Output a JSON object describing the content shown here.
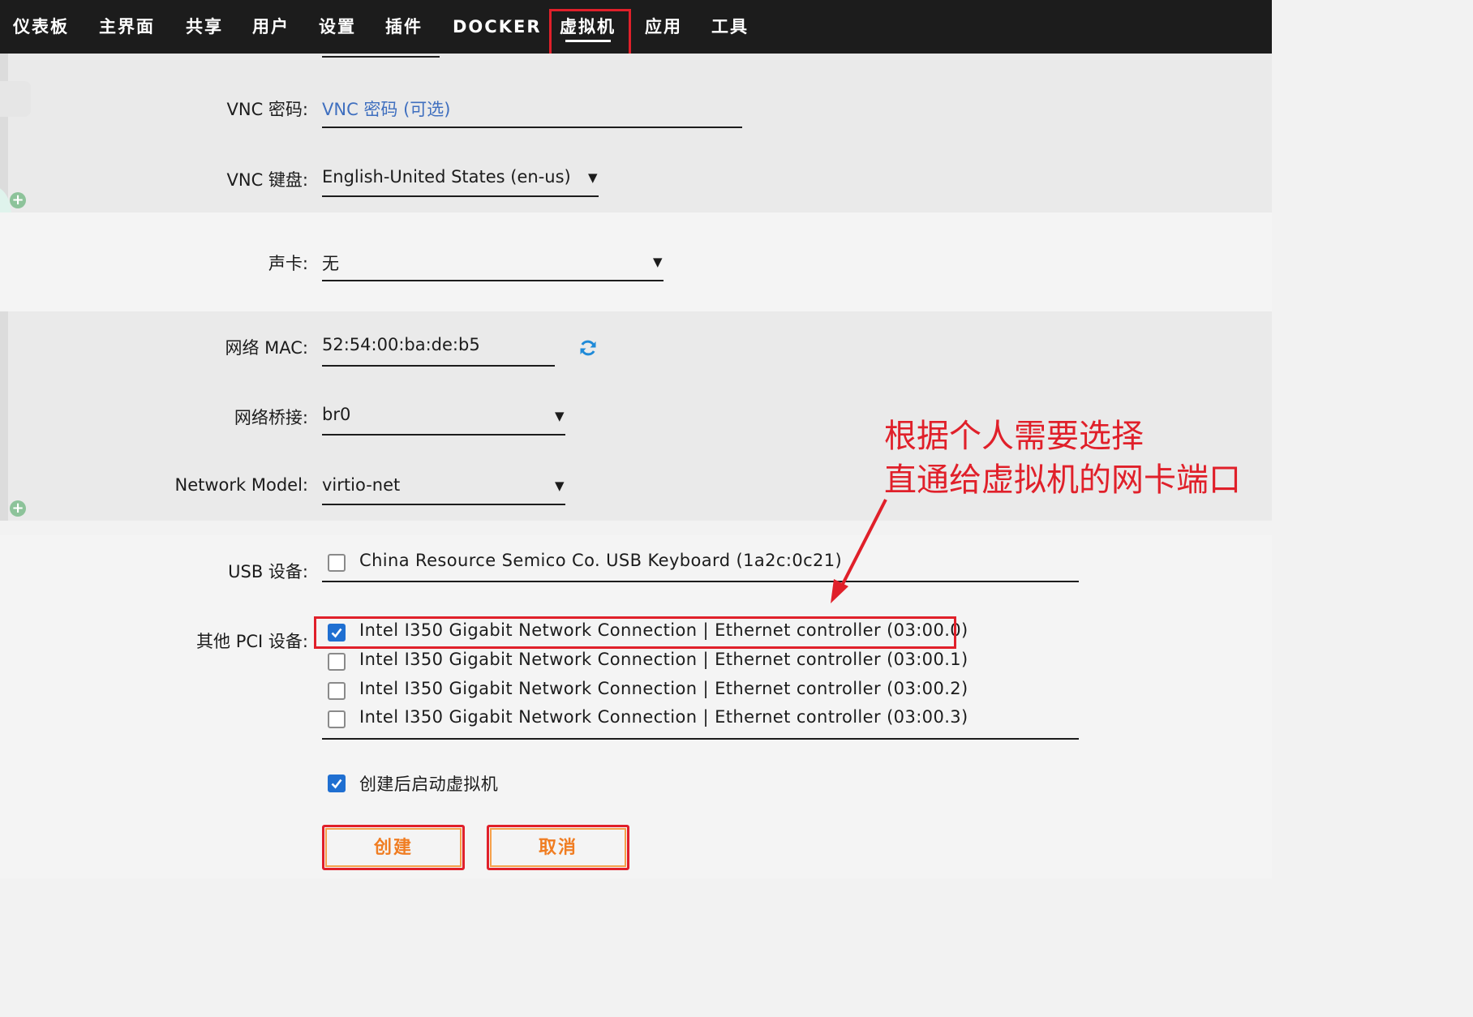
{
  "nav": {
    "items": [
      "仪表板",
      "主界面",
      "共享",
      "用户",
      "设置",
      "插件",
      "DOCKER",
      "虚拟机",
      "应用",
      "工具"
    ],
    "active_index": 7
  },
  "vnc": {
    "password_label": "VNC 密码:",
    "password_placeholder": "VNC 密码 (可选)",
    "keyboard_label": "VNC 键盘:",
    "keyboard_value": "English-United States (en-us)"
  },
  "sound": {
    "label": "声卡:",
    "value": "无"
  },
  "network": {
    "mac_label": "网络 MAC:",
    "mac_value": "52:54:00:ba:de:b5",
    "bridge_label": "网络桥接:",
    "bridge_value": "br0",
    "model_label": "Network Model:",
    "model_value": "virtio-net"
  },
  "usb": {
    "label": "USB 设备:",
    "devices": [
      {
        "name": "China Resource Semico Co. USB Keyboard (1a2c:0c21)",
        "checked": false
      }
    ]
  },
  "pci": {
    "label": "其他 PCI 设备:",
    "devices": [
      {
        "name": "Intel I350 Gigabit Network Connection | Ethernet controller (03:00.0)",
        "checked": true
      },
      {
        "name": "Intel I350 Gigabit Network Connection | Ethernet controller (03:00.1)",
        "checked": false
      },
      {
        "name": "Intel I350 Gigabit Network Connection | Ethernet controller (03:00.2)",
        "checked": false
      },
      {
        "name": "Intel I350 Gigabit Network Connection | Ethernet controller (03:00.3)",
        "checked": false
      }
    ]
  },
  "start_after_create": {
    "label": "创建后启动虚拟机",
    "checked": true
  },
  "buttons": {
    "create": "创建",
    "cancel": "取消"
  },
  "annotation": {
    "line1": "根据个人需要选择",
    "line2": "直通给虚拟机的网卡端口"
  },
  "colors": {
    "nav_bg": "#1c1c1c",
    "highlight_red": "#e0202a",
    "button_orange": "#f07d22",
    "checkbox_blue": "#1f6fd1",
    "placeholder_blue": "#3f6fbf",
    "refresh_icon": "#1f8ad8"
  }
}
